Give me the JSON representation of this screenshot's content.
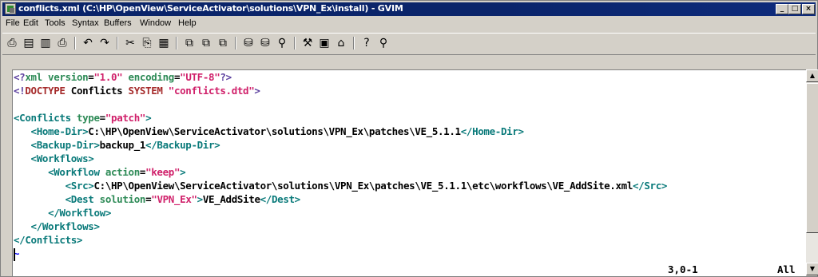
{
  "window": {
    "title": "conflicts.xml (C:\\HP\\OpenView\\ServiceActivator\\solutions\\VPN_Ex\\install) - GVIM",
    "controls": [
      "_",
      "□",
      "×"
    ]
  },
  "menu": [
    "File",
    "Edit",
    "Tools",
    "Syntax",
    "Buffers",
    "Window",
    "Help"
  ],
  "toolbar": {
    "tools": [
      {
        "name": "open-icon",
        "glyph": "⎙"
      },
      {
        "name": "save-icon",
        "glyph": "💾"
      },
      {
        "name": "save-all-icon",
        "glyph": "⎚"
      },
      {
        "name": "print-icon",
        "glyph": "⎙"
      },
      {
        "name": "undo-icon",
        "glyph": "↶"
      },
      {
        "name": "redo-icon",
        "glyph": "↷"
      },
      {
        "name": "cut-icon",
        "glyph": "✂"
      },
      {
        "name": "copy-icon",
        "glyph": "⎘"
      },
      {
        "name": "paste-icon",
        "glyph": "📋"
      },
      {
        "name": "replace-icon",
        "glyph": "⧉"
      },
      {
        "name": "find-next-icon",
        "glyph": "⧉"
      },
      {
        "name": "find-prev-icon",
        "glyph": "⧉"
      },
      {
        "name": "load-session-icon",
        "glyph": "⛁"
      },
      {
        "name": "save-session-icon",
        "glyph": "⛁"
      },
      {
        "name": "run-script-icon",
        "glyph": "⚲"
      },
      {
        "name": "make-icon",
        "glyph": "⚒"
      },
      {
        "name": "shell-icon",
        "glyph": "▣"
      },
      {
        "name": "tags-icon",
        "glyph": "⌂"
      },
      {
        "name": "help-icon",
        "glyph": "?"
      },
      {
        "name": "find-help-icon",
        "glyph": "⚲"
      }
    ]
  },
  "editor": {
    "lines": [
      [
        [
          "pi",
          "<?"
        ],
        [
          "attr",
          "xml version"
        ],
        [
          "txt",
          "="
        ],
        [
          "str",
          "\"1.0\""
        ],
        [
          "attr",
          " encoding"
        ],
        [
          "txt",
          "="
        ],
        [
          "str",
          "\"UTF-8\""
        ],
        [
          "pi",
          "?>"
        ]
      ],
      [
        [
          "pi",
          "<!"
        ],
        [
          "kw",
          "DOCTYPE"
        ],
        [
          "txt",
          " Conflicts "
        ],
        [
          "kw",
          "SYSTEM"
        ],
        [
          "str",
          " \"conflicts.dtd\""
        ],
        [
          "pi",
          ">"
        ]
      ],
      [],
      [
        [
          "tag",
          "<Conflicts"
        ],
        [
          "attr",
          " type"
        ],
        [
          "txt",
          "="
        ],
        [
          "str",
          "\"patch\""
        ],
        [
          "tag",
          ">"
        ]
      ],
      [
        [
          "txt",
          "   "
        ],
        [
          "tag",
          "<Home-Dir>"
        ],
        [
          "txt",
          "C:\\HP\\OpenView\\ServiceActivator\\solutions\\VPN_Ex\\patches\\VE_5.1.1"
        ],
        [
          "tag",
          "</Home-Dir>"
        ]
      ],
      [
        [
          "txt",
          "   "
        ],
        [
          "tag",
          "<Backup-Dir>"
        ],
        [
          "txt",
          "backup_1"
        ],
        [
          "tag",
          "</Backup-Dir>"
        ]
      ],
      [
        [
          "txt",
          "   "
        ],
        [
          "tag",
          "<Workflows>"
        ]
      ],
      [
        [
          "txt",
          "      "
        ],
        [
          "tag",
          "<Workflow"
        ],
        [
          "attr",
          " action"
        ],
        [
          "txt",
          "="
        ],
        [
          "str",
          "\"keep\""
        ],
        [
          "tag",
          ">"
        ]
      ],
      [
        [
          "txt",
          "         "
        ],
        [
          "tag",
          "<Src>"
        ],
        [
          "txt",
          "C:\\HP\\OpenView\\ServiceActivator\\solutions\\VPN_Ex\\patches\\VE_5.1.1\\etc\\workflows\\VE_AddSite.xml"
        ],
        [
          "tag",
          "</Src>"
        ]
      ],
      [
        [
          "txt",
          "         "
        ],
        [
          "tag",
          "<Dest"
        ],
        [
          "attr",
          " solution"
        ],
        [
          "txt",
          "="
        ],
        [
          "str",
          "\"VPN_Ex\""
        ],
        [
          "tag",
          ">"
        ],
        [
          "txt",
          "VE_AddSite"
        ],
        [
          "tag",
          "</Dest>"
        ]
      ],
      [
        [
          "txt",
          "      "
        ],
        [
          "tag",
          "</Workflow>"
        ]
      ],
      [
        [
          "txt",
          "   "
        ],
        [
          "tag",
          "</Workflows>"
        ]
      ],
      [
        [
          "tag",
          "</Conflicts>"
        ]
      ],
      [
        [
          "tilde",
          "~"
        ]
      ]
    ]
  },
  "status": {
    "position": "3,0-1",
    "scroll": "All"
  }
}
